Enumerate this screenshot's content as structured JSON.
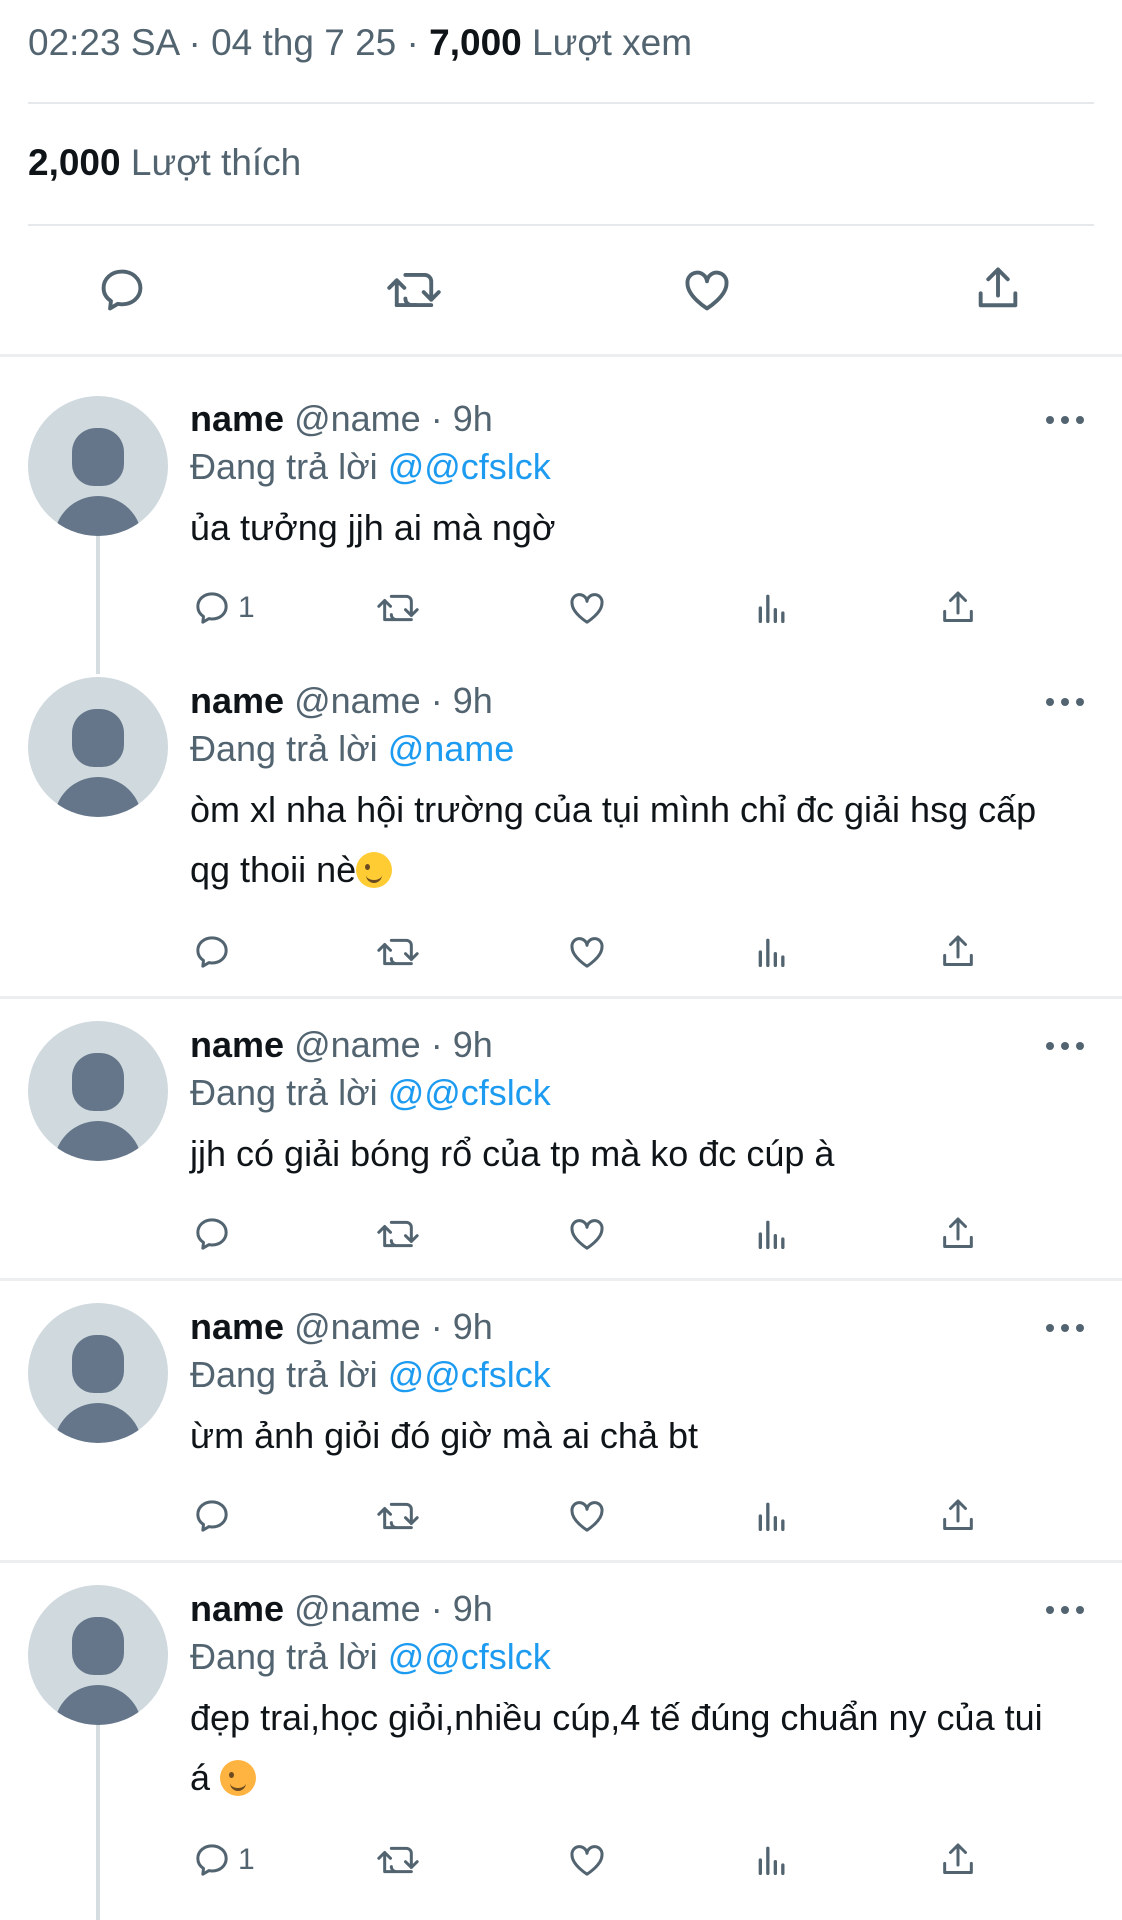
{
  "tweet_meta": {
    "time": "02:23 SA",
    "date": "04 thg 7 25",
    "views_count": "7,000",
    "views_label": "Lượt xem",
    "likes_count": "2,000",
    "likes_label": "Lượt thích",
    "separator": "·"
  },
  "actions": {
    "icons": [
      "reply-icon",
      "retweet-icon",
      "like-icon",
      "share-icon"
    ]
  },
  "replies": [
    {
      "name": "name",
      "handle": "@name",
      "age": "9h",
      "replying_label": "Đang trả lời",
      "replying_to": "@@cfslck",
      "text": "ủa tưởng jjh ai mà ngờ",
      "emoji": "",
      "reply_count": "1"
    },
    {
      "name": "name",
      "handle": "@name",
      "age": "9h",
      "replying_label": "Đang trả lời",
      "replying_to": "@name",
      "text": "òm xl nha hội trường của tụi mình chỉ đc giải hsg cấp qg thoii nè",
      "emoji": "wink-emoji",
      "reply_count": ""
    },
    {
      "name": "name",
      "handle": "@name",
      "age": "9h",
      "replying_label": "Đang trả lời",
      "replying_to": "@@cfslck",
      "text": "jjh có giải bóng rổ của tp mà ko đc cúp à",
      "emoji": "",
      "reply_count": ""
    },
    {
      "name": "name",
      "handle": "@name",
      "age": "9h",
      "replying_label": "Đang trả lời",
      "replying_to": "@@cfslck",
      "text": "ừm ảnh giỏi đó giờ mà ai chả bt",
      "emoji": "",
      "reply_count": ""
    },
    {
      "name": "name",
      "handle": "@name",
      "age": "9h",
      "replying_label": "Đang trả lời",
      "replying_to": "@@cfslck",
      "text": "đẹp trai,học giỏi,nhiều cúp,4 tế đúng chuẩn ny của tui á",
      "emoji": "steam-from-nose-emoji",
      "reply_count": "1"
    }
  ],
  "colors": {
    "accent": "#1d9bf0",
    "text": "#0f1419",
    "muted": "#536471",
    "avatar_bg": "#cfd9de",
    "avatar_fg": "#65768a"
  }
}
